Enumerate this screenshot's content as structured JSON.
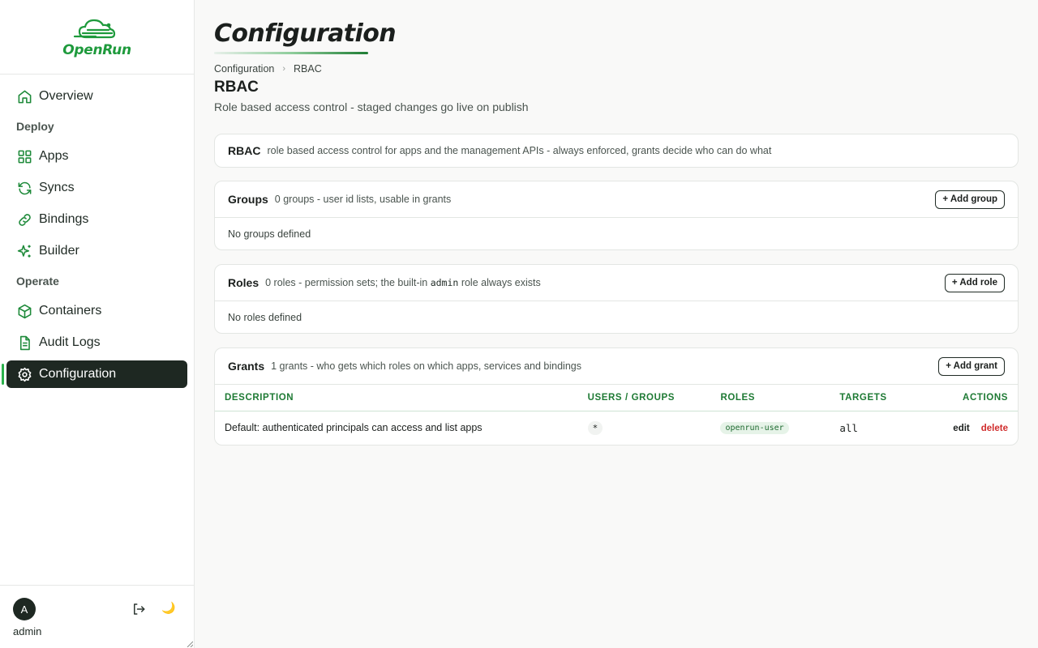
{
  "brand": {
    "name": "OpenRun",
    "color": "#1e9a3c"
  },
  "nav": {
    "overview": "Overview",
    "deploy_label": "Deploy",
    "apps": "Apps",
    "syncs": "Syncs",
    "bindings": "Bindings",
    "builder": "Builder",
    "operate_label": "Operate",
    "containers": "Containers",
    "audit_logs": "Audit Logs",
    "configuration": "Configuration",
    "active": "configuration"
  },
  "user": {
    "initial": "A",
    "name": "admin"
  },
  "page": {
    "title": "Configuration",
    "breadcrumb": [
      "Configuration",
      "RBAC"
    ],
    "section_title": "RBAC",
    "section_desc": "Role based access control - staged changes go live on publish"
  },
  "rbac_card": {
    "title": "RBAC",
    "desc": "role based access control for apps and the management APIs - always enforced, grants decide who can do what"
  },
  "groups_card": {
    "title": "Groups",
    "desc": "0 groups - user id lists, usable in grants",
    "add_label": "+ Add group",
    "empty": "No groups defined"
  },
  "roles_card": {
    "title": "Roles",
    "desc_pre": "0 roles - permission sets; the built-in",
    "desc_code": "admin",
    "desc_post": "role always exists",
    "add_label": "+ Add role",
    "empty": "No roles defined"
  },
  "grants_card": {
    "title": "Grants",
    "desc": "1 grants - who gets which roles on which apps, services and bindings",
    "add_label": "+ Add grant",
    "columns": [
      "DESCRIPTION",
      "USERS / GROUPS",
      "ROLES",
      "TARGETS",
      "ACTIONS"
    ],
    "rows": [
      {
        "description": "Default: authenticated principals can access and list apps",
        "users": "*",
        "role": "openrun-user",
        "targets": "all",
        "edit": "edit",
        "delete": "delete"
      }
    ]
  },
  "colors": {
    "accent": "#1e8a3a",
    "active_nav": "#1e2822",
    "danger": "#d02c2c",
    "header_green": "#1e7a34"
  }
}
